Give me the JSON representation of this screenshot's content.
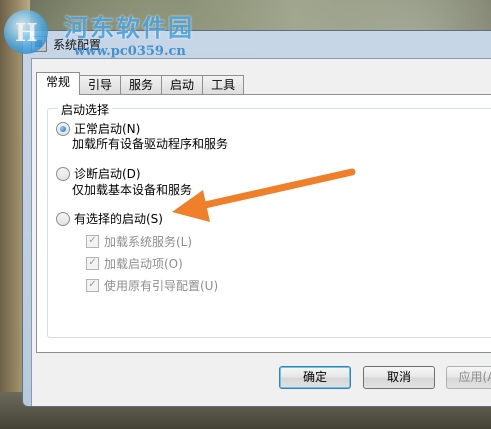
{
  "watermark": {
    "title": "河东软件园",
    "url": "www.pc0359.cn",
    "logo_char": "H"
  },
  "window": {
    "title": "系统配置",
    "icon": "msconfig-icon"
  },
  "tabs": [
    {
      "label": "常规",
      "active": true
    },
    {
      "label": "引导",
      "active": false
    },
    {
      "label": "服务",
      "active": false
    },
    {
      "label": "启动",
      "active": false
    },
    {
      "label": "工具",
      "active": false
    }
  ],
  "startup_group": {
    "label": "启动选择",
    "options": [
      {
        "label": "正常启动(N)",
        "description": "加载所有设备驱动程序和服务",
        "selected": true
      },
      {
        "label": "诊断启动(D)",
        "description": "仅加载基本设备和服务",
        "selected": false
      },
      {
        "label": "有选择的启动(S)",
        "selected": false
      }
    ],
    "checkboxes": [
      {
        "label": "加载系统服务(L)",
        "checked": true,
        "enabled": false
      },
      {
        "label": "加载启动项(O)",
        "checked": true,
        "enabled": false
      },
      {
        "label": "使用原有引导配置(U)",
        "checked": true,
        "enabled": false
      }
    ]
  },
  "buttons": {
    "ok": "确定",
    "cancel": "取消",
    "apply": "应用(A"
  },
  "annotation": {
    "arrow_color": "#f07f2a"
  }
}
